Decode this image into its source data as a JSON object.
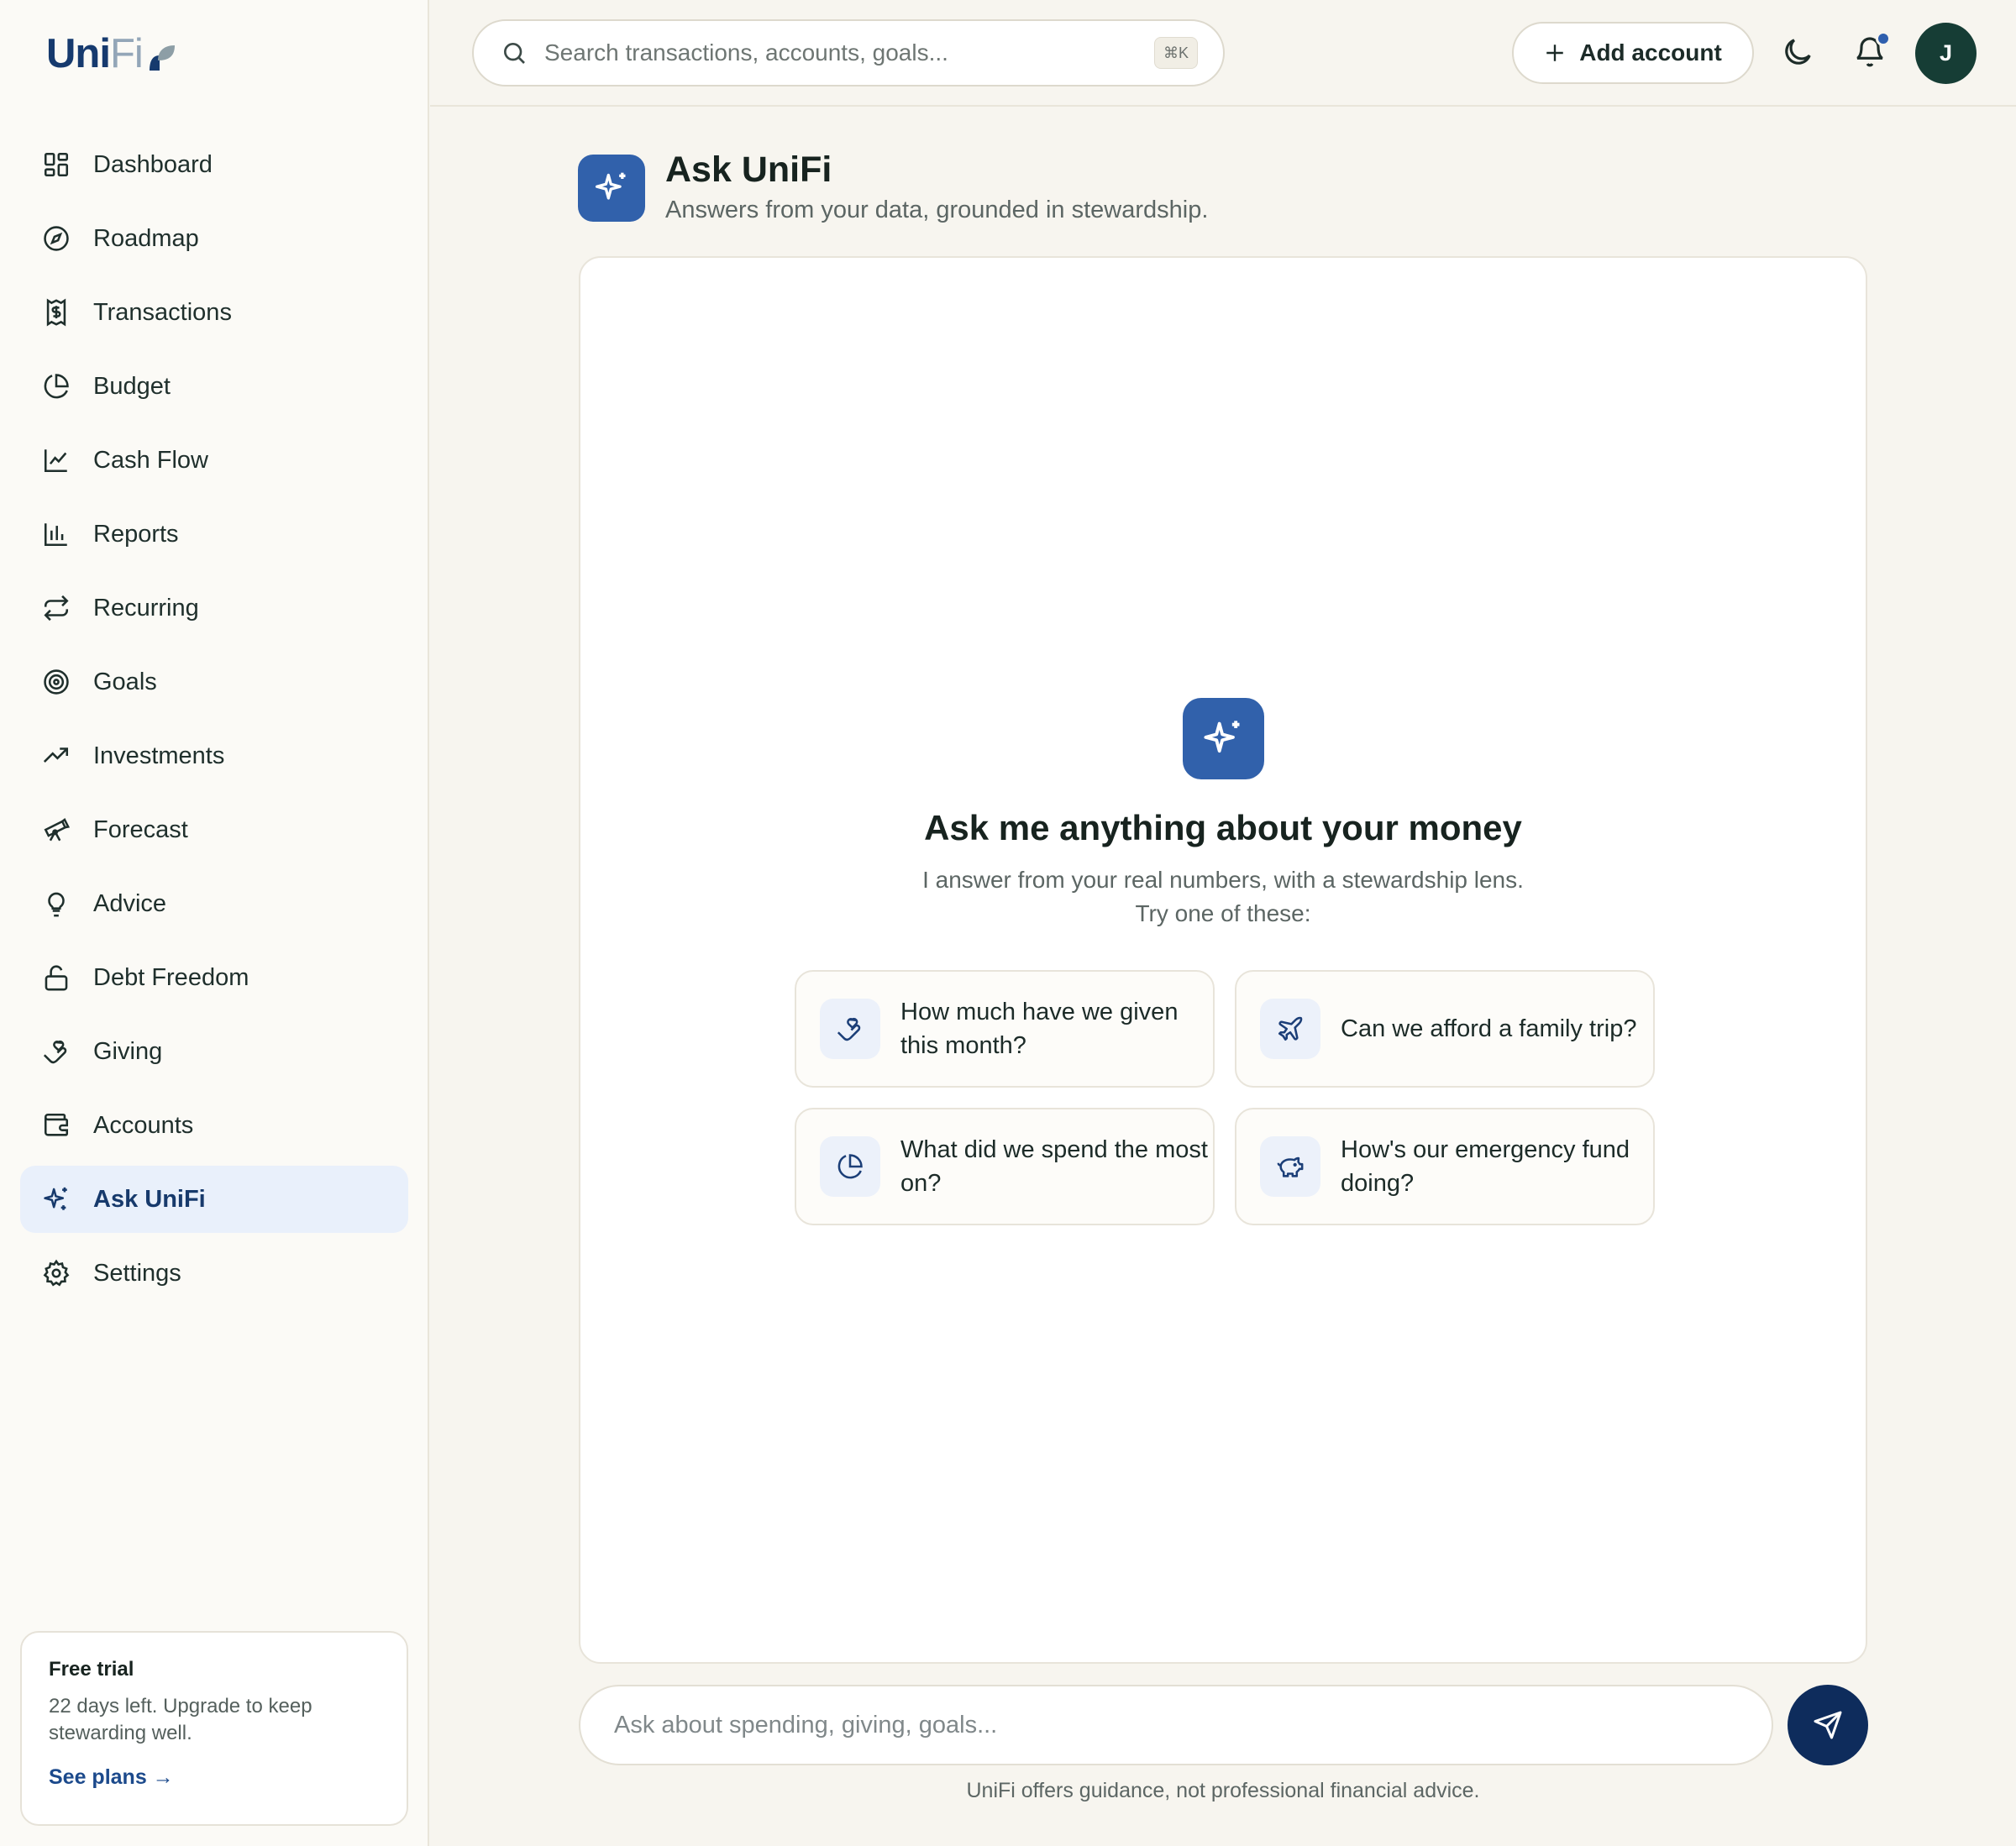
{
  "app": {
    "logo_main": "Uni",
    "logo_accent": "Fi"
  },
  "sidebar": {
    "items": [
      {
        "label": "Dashboard",
        "icon": "dashboard-icon"
      },
      {
        "label": "Roadmap",
        "icon": "compass-icon"
      },
      {
        "label": "Transactions",
        "icon": "receipt-dollar-icon"
      },
      {
        "label": "Budget",
        "icon": "pie-chart-icon"
      },
      {
        "label": "Cash Flow",
        "icon": "line-chart-icon"
      },
      {
        "label": "Reports",
        "icon": "bar-chart-icon"
      },
      {
        "label": "Recurring",
        "icon": "repeat-icon"
      },
      {
        "label": "Goals",
        "icon": "target-icon"
      },
      {
        "label": "Investments",
        "icon": "trending-up-icon"
      },
      {
        "label": "Forecast",
        "icon": "telescope-icon"
      },
      {
        "label": "Advice",
        "icon": "lightbulb-icon"
      },
      {
        "label": "Debt Freedom",
        "icon": "unlock-icon"
      },
      {
        "label": "Giving",
        "icon": "hand-heart-icon"
      },
      {
        "label": "Accounts",
        "icon": "wallet-icon"
      },
      {
        "label": "Ask UniFi",
        "icon": "sparkles-icon",
        "active": true
      },
      {
        "label": "Settings",
        "icon": "gear-icon"
      }
    ],
    "trial": {
      "title": "Free trial",
      "text": "22 days left. Upgrade to keep stewarding well.",
      "link": "See plans →"
    }
  },
  "topbar": {
    "search_placeholder": "Search transactions, accounts, goals...",
    "shortcut": "⌘K",
    "add_account": "Add account",
    "avatar_initial": "J"
  },
  "page": {
    "title": "Ask UniFi",
    "subtitle": "Answers from your data, grounded in stewardship."
  },
  "chat": {
    "empty_title": "Ask me anything about your money",
    "empty_line1": "I answer from your real numbers, with a stewardship lens.",
    "empty_line2": "Try one of these:",
    "suggestions": [
      {
        "text": "How much have we given this month?",
        "icon": "hand-heart-icon"
      },
      {
        "text": "Can we afford a family trip?",
        "icon": "plane-icon"
      },
      {
        "text": "What did we spend the most on?",
        "icon": "pie-chart-icon"
      },
      {
        "text": "How's our emergency fund doing?",
        "icon": "piggy-bank-icon"
      }
    ],
    "input_placeholder": "Ask about spending, giving, goals...",
    "disclaimer": "UniFi offers guidance, not professional financial advice."
  },
  "colors": {
    "accent": "#3161ab",
    "navy": "#0e2c5c",
    "avatar": "#163d35",
    "active_bg": "#e9f0fb",
    "background": "#f7f5ef"
  }
}
